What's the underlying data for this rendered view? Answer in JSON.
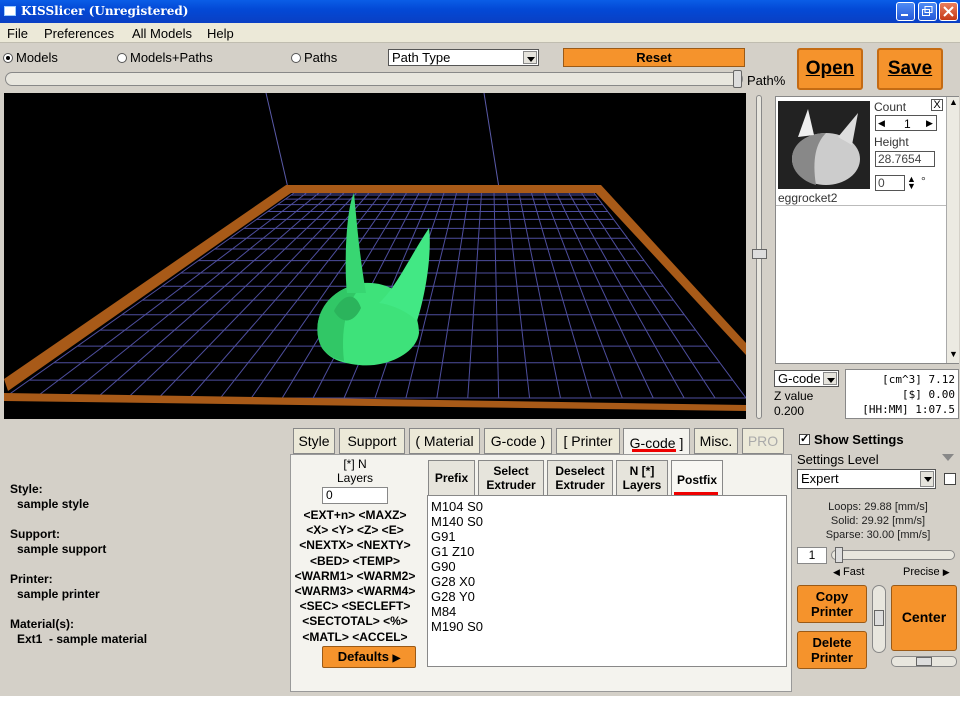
{
  "window": {
    "title": "KISSlicer (Unregistered)"
  },
  "menu": [
    "File",
    "Preferences",
    "All Models",
    "Help"
  ],
  "view_modes": [
    {
      "label": "Models",
      "selected": true
    },
    {
      "label": "Models+Paths",
      "selected": false
    },
    {
      "label": "Paths",
      "selected": false
    }
  ],
  "path_type": {
    "value": "Path Type"
  },
  "reset_label": "Reset",
  "open_label": "Open",
  "save_label": "Save",
  "path_pct_label": "Path%",
  "model": {
    "name": "eggrocket2",
    "count_label": "Count",
    "count_value": "1",
    "height_label": "Height",
    "height_value": "28.7654",
    "rotation_value": "0",
    "rotation_unit": "°",
    "close_label": "X"
  },
  "stats": {
    "dropdown": "G-code",
    "z_label": "Z value",
    "z_value": "0.200",
    "volume": "[cm^3] 7.12",
    "cost": "[$] 0.00",
    "time": "[HH:MM] 1:07.5"
  },
  "tabs": [
    {
      "label": "Style",
      "active": false,
      "disabled": false
    },
    {
      "label": "Support",
      "active": false,
      "disabled": false
    },
    {
      "label": "( Material",
      "active": false,
      "disabled": false
    },
    {
      "label": "G-code )",
      "active": false,
      "disabled": false
    },
    {
      "label": "[ Printer",
      "active": false,
      "disabled": false
    },
    {
      "label": "G-code ]",
      "active": true,
      "disabled": false
    },
    {
      "label": "Misc.",
      "active": false,
      "disabled": false
    },
    {
      "label": "PRO",
      "active": false,
      "disabled": true
    }
  ],
  "summary": {
    "style_label": "Style:",
    "style_value": "sample style",
    "support_label": "Support:",
    "support_value": "sample support",
    "printer_label": "Printer:",
    "printer_value": "sample printer",
    "material_label": "Material(s):",
    "material_value": "Ext1  - sample material"
  },
  "gcode_panel": {
    "layers_label": "[*] N\nLayers",
    "layers_value": "0",
    "tokens": [
      "<EXT+n> <MAXZ>",
      "<X> <Y> <Z> <E>",
      "<NEXTX> <NEXTY>",
      "<BED> <TEMP>",
      "<WARM1> <WARM2>",
      "<WARM3> <WARM4>",
      "<SEC> <SECLEFT>",
      "<SECTOTAL> <%>",
      "<MATL> <ACCEL>"
    ],
    "defaults_label": "Defaults",
    "subtabs": [
      {
        "label": "Prefix",
        "active": false
      },
      {
        "label": "Select\nExtruder",
        "active": false
      },
      {
        "label": "Deselect\nExtruder",
        "active": false
      },
      {
        "label": "N [*]\nLayers",
        "active": false
      },
      {
        "label": "Postfix",
        "active": true
      }
    ],
    "code": [
      "M104 S0",
      "M140 S0",
      "G91",
      "G1 Z10",
      "G90",
      "G28 X0",
      "G28 Y0",
      "M84",
      "M190 S0"
    ]
  },
  "settings": {
    "show_settings_label": "Show Settings",
    "show_settings_checked": true,
    "level_label": "Settings Level",
    "level_value": "Expert",
    "loops": "Loops:  29.88 [mm/s]",
    "solid": "Solid:  29.92 [mm/s]",
    "sparse": "Sparse: 30.00 [mm/s]",
    "speed_value": "1",
    "fast_label": "Fast",
    "precise_label": "Precise",
    "copy_printer_label": "Copy\nPrinter",
    "delete_printer_label": "Delete\nPrinter",
    "center_label": "Center"
  },
  "colors": {
    "accent": "#f5932c",
    "model_green": "#3ee27a",
    "grid": "#5a5aa8",
    "bed_border": "#b0601a"
  }
}
